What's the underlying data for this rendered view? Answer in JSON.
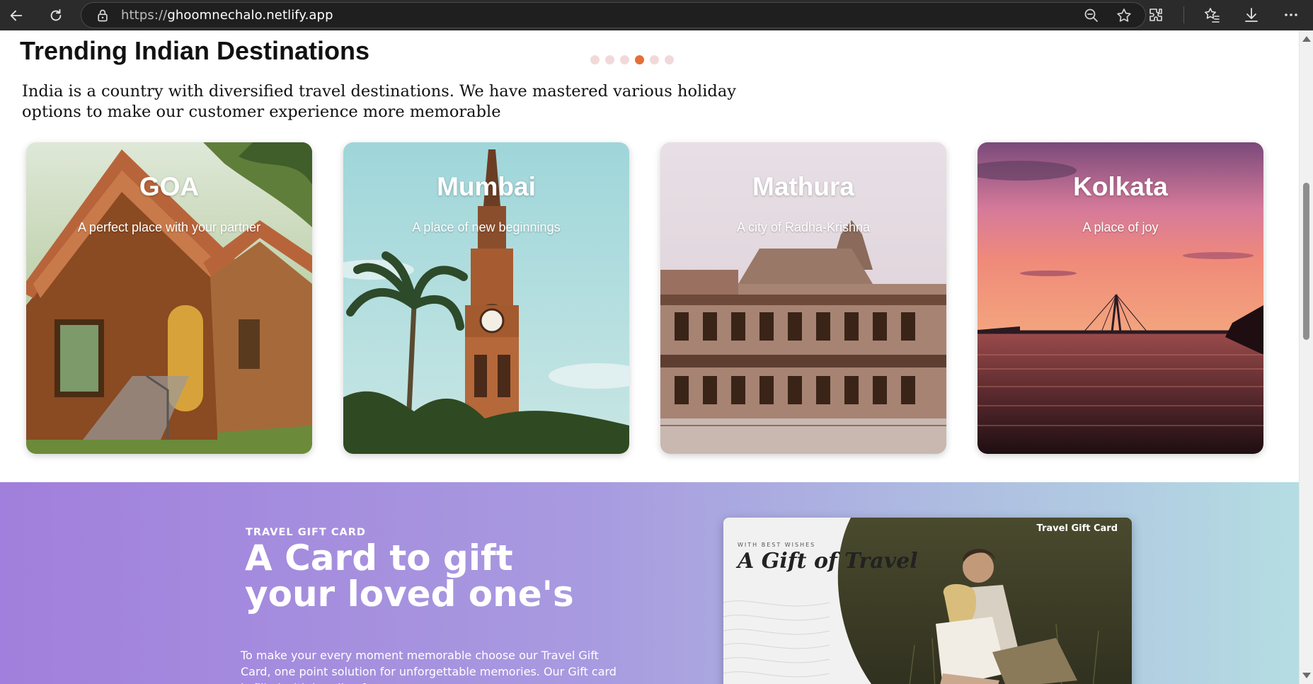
{
  "browser": {
    "url_protocol": "https://",
    "url_host": "ghoomnechalo.netlify.app"
  },
  "trending": {
    "title": "Trending Indian Destinations",
    "intro": "India is a country with diversified travel destinations. We have mastered various holiday options to make our customer experience more memorable",
    "carousel_dots": 6,
    "active_dot": 4,
    "cards": [
      {
        "title": "GOA",
        "subtitle": "A perfect place with your partner",
        "image": "goa-cottage"
      },
      {
        "title": "Mumbai",
        "subtitle": "A place of new beginnings",
        "image": "clock-tower"
      },
      {
        "title": "Mathura",
        "subtitle": "A city of Radha-Krishna",
        "image": "temple"
      },
      {
        "title": "Kolkata",
        "subtitle": "A place of joy",
        "image": "sunset-bridge"
      }
    ]
  },
  "gift": {
    "tag": "TRAVEL GIFT CARD",
    "headline_line1": "A Card to gift",
    "headline_line2": "your loved one's",
    "body": "To make your every moment memorable choose our Travel Gift Card, one point solution for unforgettable memories. Our Gift card is filled with bundle of",
    "card_label": "Travel Gift Card",
    "card_wishes": "WITH BEST WISHES",
    "card_script": "A Gift of Travel"
  },
  "colors": {
    "accent_dot": "#e2703a",
    "inactive_dot": "#f2d9d9",
    "gift_gradient_start": "#a17fdc",
    "gift_gradient_end": "#b4dde2"
  }
}
